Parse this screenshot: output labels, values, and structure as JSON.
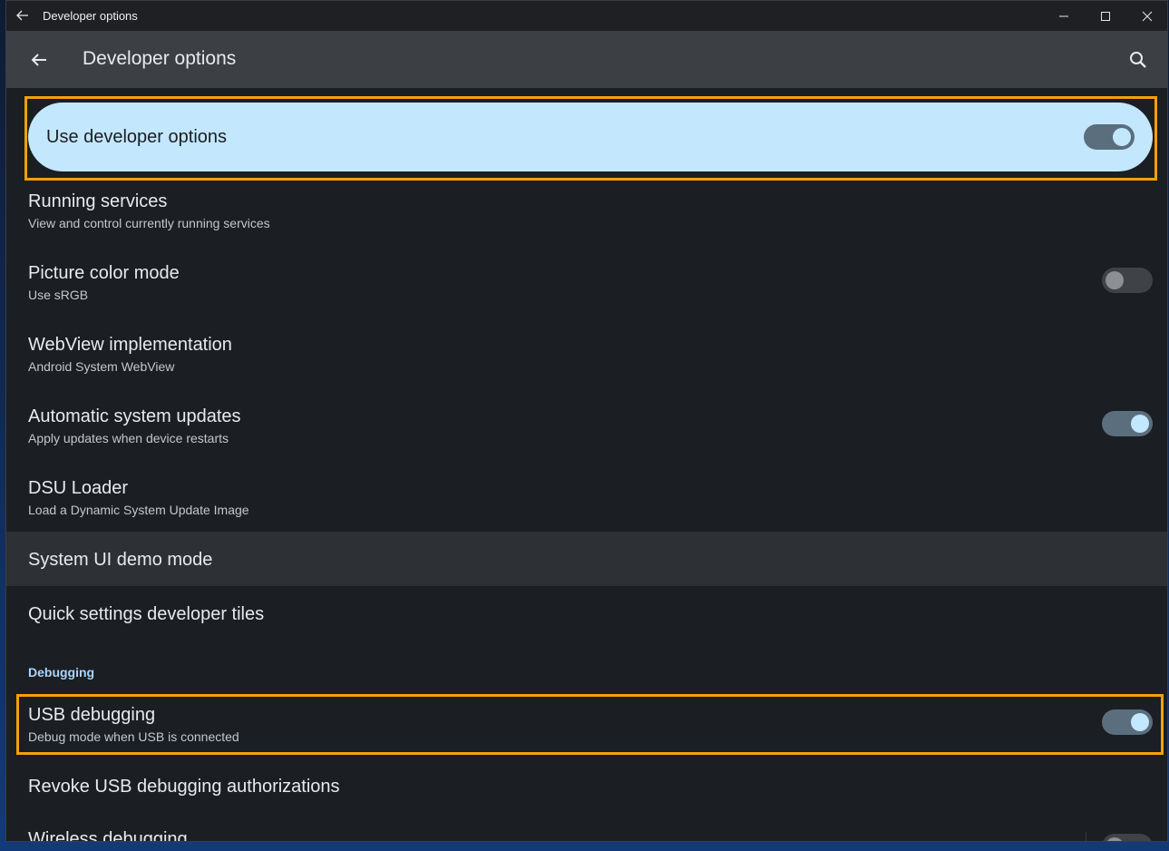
{
  "window": {
    "title": "Developer options",
    "controls": [
      "minimize",
      "maximize",
      "close"
    ]
  },
  "appbar": {
    "title": "Developer options",
    "back_icon": "arrow-back-icon",
    "search_icon": "search-icon"
  },
  "main_toggle": {
    "label": "Use developer options",
    "on": true
  },
  "items": [
    {
      "title": "Running services",
      "subtitle": "View and control currently running services"
    },
    {
      "title": "Picture color mode",
      "subtitle": "Use sRGB",
      "toggle": false
    },
    {
      "title": "WebView implementation",
      "subtitle": "Android System WebView"
    },
    {
      "title": "Automatic system updates",
      "subtitle": "Apply updates when device restarts",
      "toggle": true
    },
    {
      "title": "DSU Loader",
      "subtitle": "Load a Dynamic System Update Image"
    },
    {
      "title": "System UI demo mode"
    },
    {
      "title": "Quick settings developer tiles"
    }
  ],
  "debugging": {
    "header": "Debugging",
    "items": [
      {
        "title": "USB debugging",
        "subtitle": "Debug mode when USB is connected",
        "toggle": true
      },
      {
        "title": "Revoke USB debugging authorizations"
      },
      {
        "title": "Wireless debugging",
        "toggle": false
      }
    ]
  },
  "colors": {
    "accent": "#c3e7fd",
    "highlight": "#f5a00e",
    "background": "#1b1e22",
    "appbar": "#3c3f43"
  }
}
